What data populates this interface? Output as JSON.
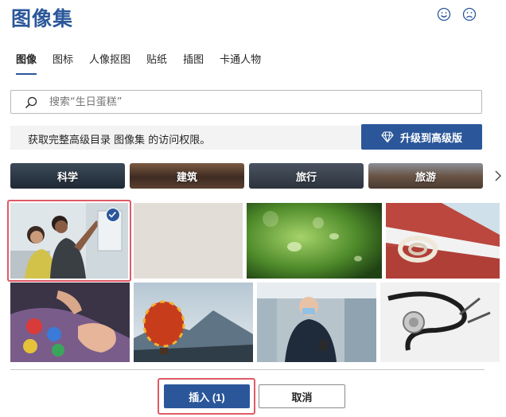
{
  "dialog": {
    "title": "图像集",
    "smile_icon": "smiley-face-icon",
    "frown_icon": "frown-face-icon"
  },
  "tabs": [
    {
      "label": "图像",
      "active": true
    },
    {
      "label": "图标",
      "active": false
    },
    {
      "label": "人像抠图",
      "active": false
    },
    {
      "label": "贴纸",
      "active": false
    },
    {
      "label": "插图",
      "active": false
    },
    {
      "label": "卡通人物",
      "active": false
    }
  ],
  "search": {
    "value": "",
    "placeholder": "搜索“生日蛋糕”",
    "icon": "search-icon"
  },
  "notice": {
    "text": "获取完整高级目录 图像集 的访问权限。",
    "upgrade_label": "升级到高级版",
    "upgrade_icon": "diamond-icon"
  },
  "categories": [
    {
      "label": "科学"
    },
    {
      "label": "建筑"
    },
    {
      "label": "旅行"
    },
    {
      "label": "旅游"
    }
  ],
  "photos": [
    {
      "subject": "people-at-whiteboard",
      "selected": true
    },
    {
      "subject": "linen-texture",
      "selected": false
    },
    {
      "subject": "water-droplets-on-leaf",
      "selected": false
    },
    {
      "subject": "sailboat-rope",
      "selected": false
    },
    {
      "subject": "paint-palette-hands",
      "selected": false
    },
    {
      "subject": "hot-air-balloon",
      "selected": false
    },
    {
      "subject": "man-with-mask-on-train",
      "selected": false
    },
    {
      "subject": "stethoscope",
      "selected": false
    }
  ],
  "footer": {
    "insert_label": "插入 (1)",
    "cancel_label": "取消"
  },
  "colors": {
    "accent": "#2b579a",
    "selection": "#e05a66"
  }
}
